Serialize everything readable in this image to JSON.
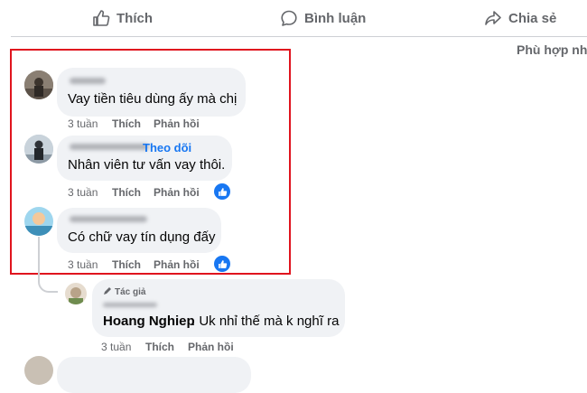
{
  "actions": {
    "like": "Thích",
    "comment": "Bình luận",
    "share": "Chia sẻ"
  },
  "sort_label": "Phù hợp nh",
  "comments": [
    {
      "text": "Vay tiền tiêu dùng ấy mà chị",
      "time": "3 tuần",
      "like": "Thích",
      "reply": "Phản hồi"
    },
    {
      "follow": "Theo dõi",
      "text": "Nhân viên tư vấn vay thôi.",
      "time": "3 tuần",
      "like": "Thích",
      "reply": "Phản hồi"
    },
    {
      "text": "Có chữ vay tín dụng đấy",
      "time": "3 tuần",
      "like": "Thích",
      "reply": "Phản hồi"
    }
  ],
  "reply": {
    "role": "Tác giả",
    "author": "Hoang Nghiep",
    "text": ". Uk nhỉ thế mà k nghĩ ra",
    "time": "3 tuần",
    "like": "Thích",
    "reply": "Phản hồi"
  },
  "colors": {
    "accent": "#1877f2",
    "highlight": "#e0141e",
    "bubble": "#f0f2f5",
    "meta": "#65676b"
  },
  "icons": [
    "thumbs-up-icon",
    "comment-icon",
    "share-icon",
    "like-reaction-icon",
    "pencil-icon"
  ]
}
